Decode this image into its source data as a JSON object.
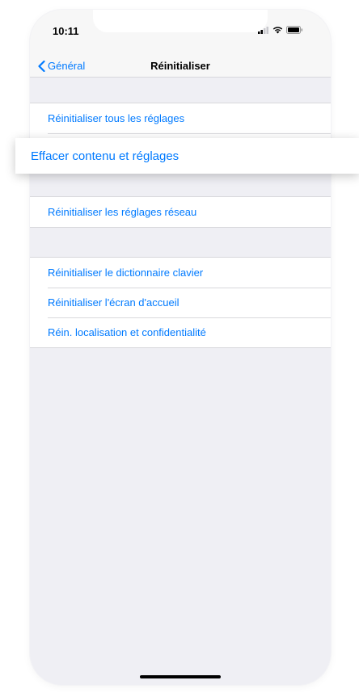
{
  "status_bar": {
    "time": "10:11",
    "icons": [
      "cellular-signal-icon",
      "wifi-icon",
      "battery-icon"
    ]
  },
  "nav": {
    "back_label": "Général",
    "back_icon": "chevron-left-icon",
    "title": "Réinitialiser"
  },
  "groups": [
    {
      "items": [
        {
          "label": "Réinitialiser tous les réglages"
        },
        {
          "label": "Effacer contenu et réglages",
          "highlighted": true
        }
      ]
    },
    {
      "items": [
        {
          "label": "Réinitialiser les réglages réseau"
        }
      ]
    },
    {
      "items": [
        {
          "label": "Réinitialiser le dictionnaire clavier"
        },
        {
          "label": "Réinitialiser l'écran d'accueil"
        },
        {
          "label": "Réin. localisation et confidentialité"
        }
      ]
    }
  ],
  "colors": {
    "accent": "#007aff",
    "background": "#efeff4",
    "separator": "#d8d8dc",
    "cell": "#ffffff"
  }
}
